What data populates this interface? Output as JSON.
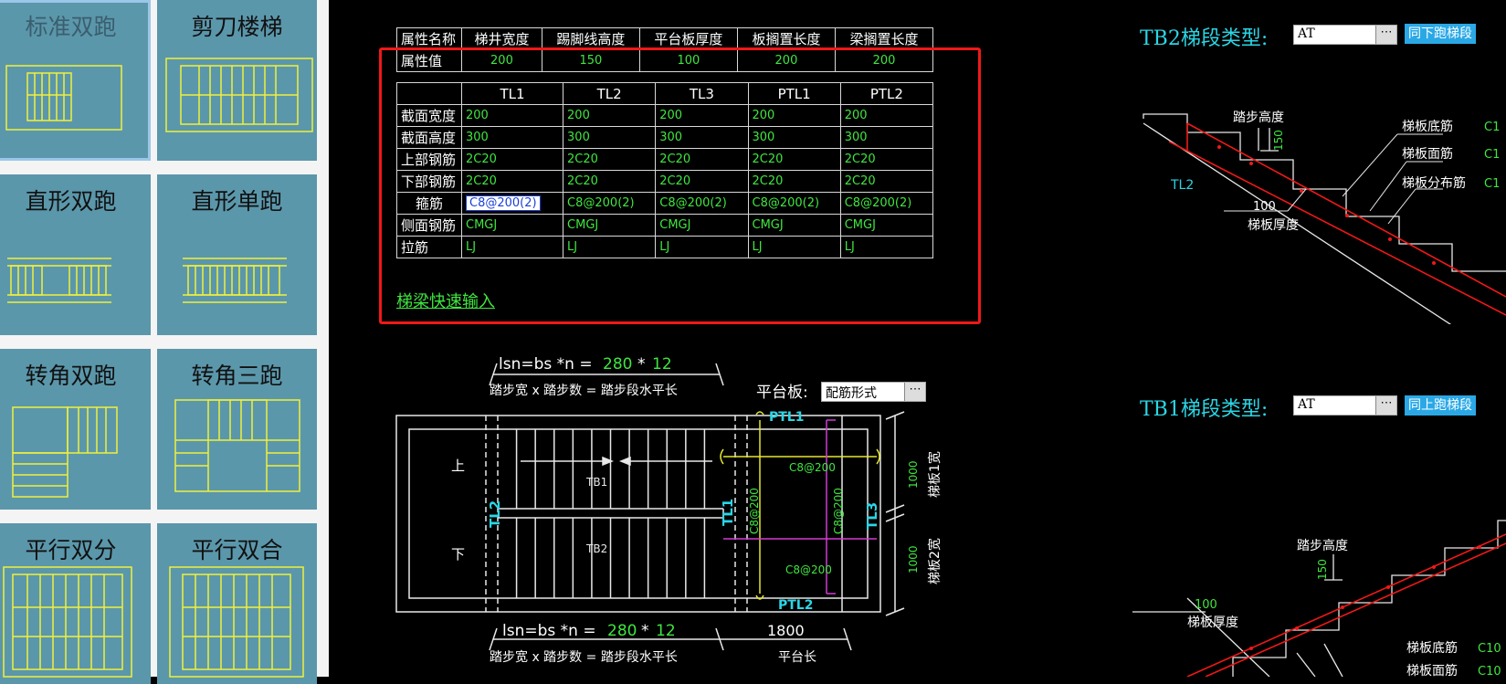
{
  "palette": [
    {
      "label": "标准双跑"
    },
    {
      "label": "剪刀楼梯"
    },
    {
      "label": "直形双跑"
    },
    {
      "label": "直形单跑"
    },
    {
      "label": "转角双跑"
    },
    {
      "label": "转角三跑"
    },
    {
      "label": "平行双分"
    },
    {
      "label": "平行双合"
    }
  ],
  "props_table": {
    "headers": [
      "属性名称",
      "梯井宽度",
      "踢脚线高度",
      "平台板厚度",
      "板搁置长度",
      "梁搁置长度"
    ],
    "row_label": "属性值",
    "values": [
      "200",
      "150",
      "100",
      "200",
      "200"
    ]
  },
  "beam_table": {
    "columns": [
      "TL1",
      "TL2",
      "TL3",
      "PTL1",
      "PTL2"
    ],
    "rows": [
      {
        "label": "截面宽度",
        "values": [
          "200",
          "200",
          "200",
          "200",
          "200"
        ]
      },
      {
        "label": "截面高度",
        "values": [
          "300",
          "300",
          "300",
          "300",
          "300"
        ]
      },
      {
        "label": "上部钢筋",
        "values": [
          "2C20",
          "2C20",
          "2C20",
          "2C20",
          "2C20"
        ]
      },
      {
        "label": "下部钢筋",
        "values": [
          "2C20",
          "2C20",
          "2C20",
          "2C20",
          "2C20"
        ]
      },
      {
        "label": "箍筋",
        "values": [
          "C8@200(2)",
          "C8@200(2)",
          "C8@200(2)",
          "C8@200(2)",
          "C8@200(2)"
        ]
      },
      {
        "label": "侧面钢筋",
        "values": [
          "CMGJ",
          "CMGJ",
          "CMGJ",
          "CMGJ",
          "CMGJ"
        ]
      },
      {
        "label": "拉筋",
        "values": [
          "LJ",
          "LJ",
          "LJ",
          "LJ",
          "LJ"
        ]
      }
    ]
  },
  "quick_input_link": "梯梁快速输入",
  "plan": {
    "formula": "lsn=bs *n =",
    "bs": "280",
    "star": "*",
    "n": "12",
    "formula_caption": "踏步宽 x 踏步数 = 踏步段水平长",
    "platform_label": "平台板:",
    "platform_value": "配筋形式",
    "up": "上",
    "down": "下",
    "tb1": "TB1",
    "tb2": "TB2",
    "tl1": "TL1",
    "tl2": "TL2",
    "tl3": "TL3",
    "ptl1": "PTL1",
    "ptl2": "PTL2",
    "rebar_h": "C8@200",
    "rebar_v": "C8@200",
    "dim_1000a": "1000",
    "dim_1000b": "1000",
    "width1": "梯板1宽",
    "width2": "梯板2宽",
    "platform_len": "1800",
    "platform_len_label": "平台长"
  },
  "tb2": {
    "title": "TB2梯段类型:",
    "type_value": "AT",
    "button": "同下跑梯段",
    "step_height": "踏步高度",
    "step_h_val": "150",
    "tl2": "TL2",
    "thk_val": "100",
    "thk_label": "梯板厚度",
    "bottom_bar": "梯板底筋",
    "top_bar": "梯板面筋",
    "dist_bar": "梯板分布筋",
    "bar_prefix": "C1"
  },
  "tb1": {
    "title": "TB1梯段类型:",
    "type_value": "AT",
    "button": "同上跑梯段",
    "step_height": "踏步高度",
    "step_h_val": "150",
    "thk_val": "100",
    "thk_label": "梯板厚度",
    "bottom_bar": "梯板底筋",
    "top_bar": "梯板面筋",
    "bar_prefix": "C10"
  }
}
